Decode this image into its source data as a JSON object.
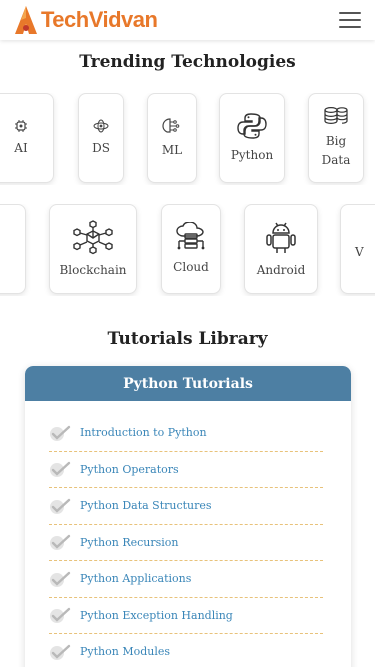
{
  "header": {
    "logo_part1": "Tech",
    "logo_part2": "Vidvan"
  },
  "trending": {
    "title": "Trending Technologies",
    "row1": [
      {
        "label": "AI",
        "icon": "ai-chip-icon"
      },
      {
        "label": "DS",
        "icon": "data-science-icon"
      },
      {
        "label": "ML",
        "icon": "machine-learning-icon"
      },
      {
        "label": "Python",
        "icon": "python-icon"
      },
      {
        "label": "Big Data",
        "icon": "big-data-icon"
      }
    ],
    "row2": [
      {
        "label": "",
        "icon": ""
      },
      {
        "label": "Blockchain",
        "icon": "blockchain-icon"
      },
      {
        "label": "Cloud",
        "icon": "cloud-icon"
      },
      {
        "label": "Android",
        "icon": "android-icon"
      },
      {
        "label": "V",
        "icon": ""
      }
    ]
  },
  "tutorials": {
    "title": "Tutorials Library",
    "card_title": "Python Tutorials",
    "items": [
      "Introduction to Python",
      "Python Operators",
      "Python Data Structures",
      "Python Recursion",
      "Python Applications",
      "Python Exception Handling",
      "Python Modules"
    ]
  },
  "colors": {
    "brand": "#e8782a",
    "header_blue": "#4d7fa3",
    "link": "#3a86b8",
    "divider": "#e8c27a"
  }
}
